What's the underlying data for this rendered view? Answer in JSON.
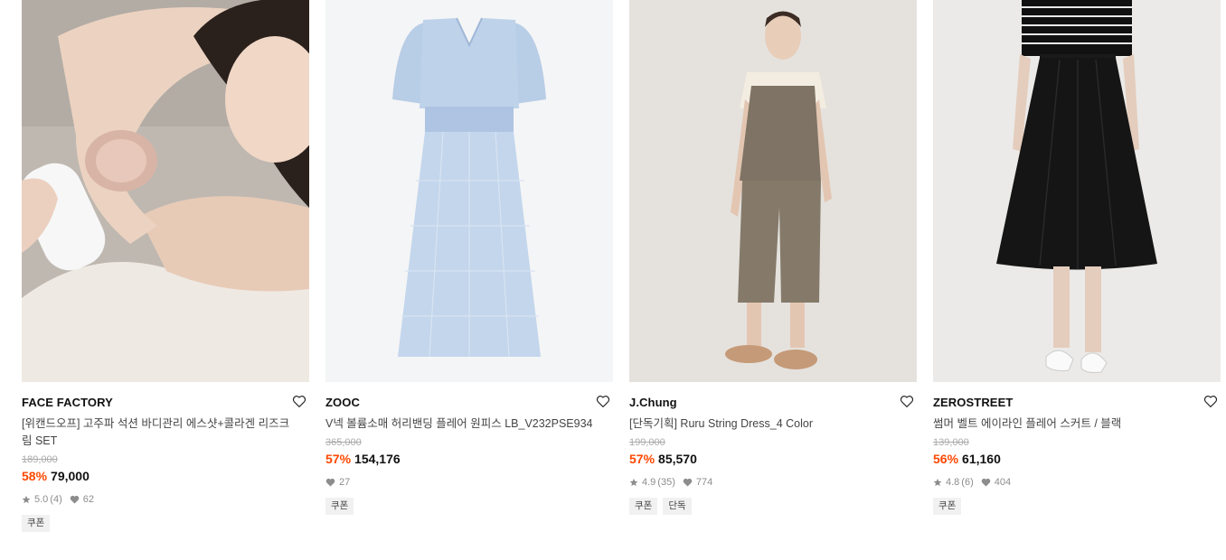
{
  "products": [
    {
      "brand": "FACE FACTORY",
      "title": "[위캔드오프] 고주파 석션 바디관리 에스샷+콜라겐 리즈크림 SET",
      "original_price": "189,000",
      "discount": "58%",
      "price": "79,000",
      "rating": "5.0",
      "reviews": "(4)",
      "likes": "62",
      "badges": [
        "쿠폰"
      ],
      "image_bg": "#c9c2bb"
    },
    {
      "brand": "ZOOC",
      "title": "V넥 볼륨소매 허리밴딩 플레어 원피스 LB_V232PSE934",
      "original_price": "365,000",
      "discount": "57%",
      "price": "154,176",
      "likes": "27",
      "badges": [
        "쿠폰"
      ],
      "image_bg": "#f3f4f5"
    },
    {
      "brand": "J.Chung",
      "title": "[단독기획] Ruru String Dress_4 Color",
      "original_price": "199,000",
      "discount": "57%",
      "price": "85,570",
      "rating": "4.9",
      "reviews": "(35)",
      "likes": "774",
      "badges": [
        "쿠폰",
        "단독"
      ],
      "image_bg": "#e6e3df"
    },
    {
      "brand": "ZEROSTREET",
      "title": "썸머 벨트 에이라인 플레어 스커트 / 블랙",
      "original_price": "139,000",
      "discount": "56%",
      "price": "61,160",
      "rating": "4.8",
      "reviews": "(6)",
      "likes": "404",
      "badges": [
        "쿠폰"
      ],
      "image_bg": "#ecebe9"
    }
  ],
  "icons": {
    "wishlist": "heart-outline-icon",
    "rating": "star-icon",
    "likes": "heart-filled-icon"
  },
  "colors": {
    "discount": "#ff4800",
    "meta": "#8d8d8d"
  }
}
